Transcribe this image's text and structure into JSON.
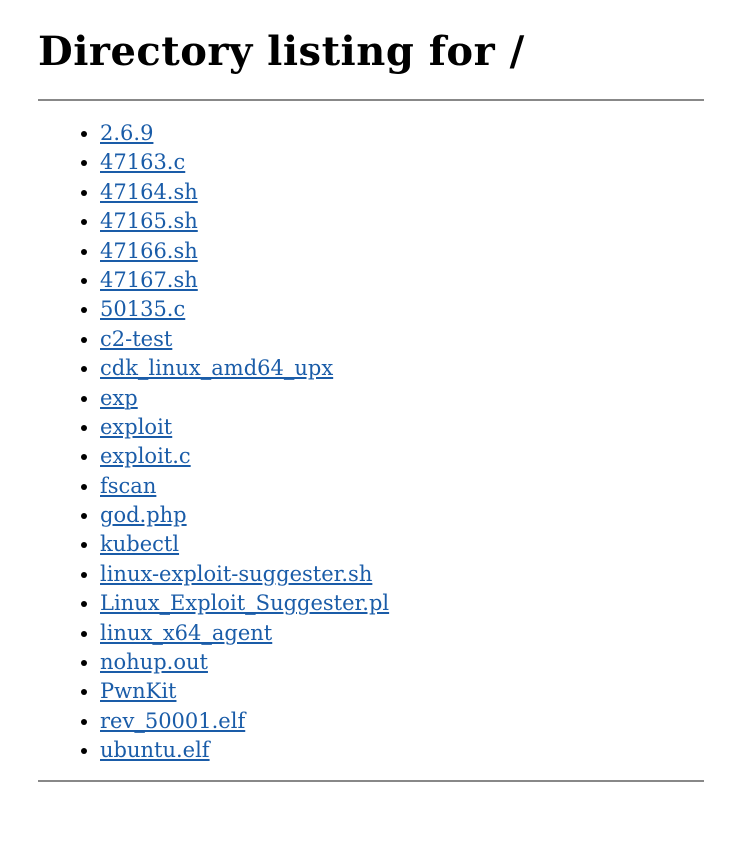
{
  "heading": "Directory listing for /",
  "files": [
    "2.6.9",
    "47163.c",
    "47164.sh",
    "47165.sh",
    "47166.sh",
    "47167.sh",
    "50135.c",
    "c2-test",
    "cdk_linux_amd64_upx",
    "exp",
    "exploit",
    "exploit.c",
    "fscan",
    "god.php",
    "kubectl",
    "linux-exploit-suggester.sh",
    "Linux_Exploit_Suggester.pl",
    "linux_x64_agent",
    "nohup.out",
    "PwnKit",
    "rev_50001.elf",
    "ubuntu.elf"
  ]
}
